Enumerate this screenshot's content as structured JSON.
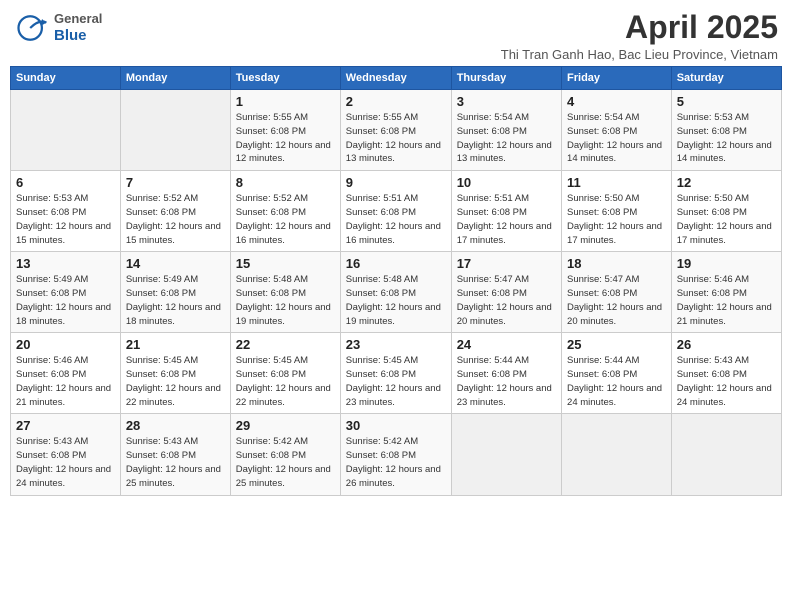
{
  "logo": {
    "general": "General",
    "blue": "Blue"
  },
  "title": "April 2025",
  "subtitle": "Thi Tran Ganh Hao, Bac Lieu Province, Vietnam",
  "days_header": [
    "Sunday",
    "Monday",
    "Tuesday",
    "Wednesday",
    "Thursday",
    "Friday",
    "Saturday"
  ],
  "weeks": [
    [
      {
        "day": "",
        "info": ""
      },
      {
        "day": "",
        "info": ""
      },
      {
        "day": "1",
        "info": "Sunrise: 5:55 AM\nSunset: 6:08 PM\nDaylight: 12 hours and 12 minutes."
      },
      {
        "day": "2",
        "info": "Sunrise: 5:55 AM\nSunset: 6:08 PM\nDaylight: 12 hours and 13 minutes."
      },
      {
        "day": "3",
        "info": "Sunrise: 5:54 AM\nSunset: 6:08 PM\nDaylight: 12 hours and 13 minutes."
      },
      {
        "day": "4",
        "info": "Sunrise: 5:54 AM\nSunset: 6:08 PM\nDaylight: 12 hours and 14 minutes."
      },
      {
        "day": "5",
        "info": "Sunrise: 5:53 AM\nSunset: 6:08 PM\nDaylight: 12 hours and 14 minutes."
      }
    ],
    [
      {
        "day": "6",
        "info": "Sunrise: 5:53 AM\nSunset: 6:08 PM\nDaylight: 12 hours and 15 minutes."
      },
      {
        "day": "7",
        "info": "Sunrise: 5:52 AM\nSunset: 6:08 PM\nDaylight: 12 hours and 15 minutes."
      },
      {
        "day": "8",
        "info": "Sunrise: 5:52 AM\nSunset: 6:08 PM\nDaylight: 12 hours and 16 minutes."
      },
      {
        "day": "9",
        "info": "Sunrise: 5:51 AM\nSunset: 6:08 PM\nDaylight: 12 hours and 16 minutes."
      },
      {
        "day": "10",
        "info": "Sunrise: 5:51 AM\nSunset: 6:08 PM\nDaylight: 12 hours and 17 minutes."
      },
      {
        "day": "11",
        "info": "Sunrise: 5:50 AM\nSunset: 6:08 PM\nDaylight: 12 hours and 17 minutes."
      },
      {
        "day": "12",
        "info": "Sunrise: 5:50 AM\nSunset: 6:08 PM\nDaylight: 12 hours and 17 minutes."
      }
    ],
    [
      {
        "day": "13",
        "info": "Sunrise: 5:49 AM\nSunset: 6:08 PM\nDaylight: 12 hours and 18 minutes."
      },
      {
        "day": "14",
        "info": "Sunrise: 5:49 AM\nSunset: 6:08 PM\nDaylight: 12 hours and 18 minutes."
      },
      {
        "day": "15",
        "info": "Sunrise: 5:48 AM\nSunset: 6:08 PM\nDaylight: 12 hours and 19 minutes."
      },
      {
        "day": "16",
        "info": "Sunrise: 5:48 AM\nSunset: 6:08 PM\nDaylight: 12 hours and 19 minutes."
      },
      {
        "day": "17",
        "info": "Sunrise: 5:47 AM\nSunset: 6:08 PM\nDaylight: 12 hours and 20 minutes."
      },
      {
        "day": "18",
        "info": "Sunrise: 5:47 AM\nSunset: 6:08 PM\nDaylight: 12 hours and 20 minutes."
      },
      {
        "day": "19",
        "info": "Sunrise: 5:46 AM\nSunset: 6:08 PM\nDaylight: 12 hours and 21 minutes."
      }
    ],
    [
      {
        "day": "20",
        "info": "Sunrise: 5:46 AM\nSunset: 6:08 PM\nDaylight: 12 hours and 21 minutes."
      },
      {
        "day": "21",
        "info": "Sunrise: 5:45 AM\nSunset: 6:08 PM\nDaylight: 12 hours and 22 minutes."
      },
      {
        "day": "22",
        "info": "Sunrise: 5:45 AM\nSunset: 6:08 PM\nDaylight: 12 hours and 22 minutes."
      },
      {
        "day": "23",
        "info": "Sunrise: 5:45 AM\nSunset: 6:08 PM\nDaylight: 12 hours and 23 minutes."
      },
      {
        "day": "24",
        "info": "Sunrise: 5:44 AM\nSunset: 6:08 PM\nDaylight: 12 hours and 23 minutes."
      },
      {
        "day": "25",
        "info": "Sunrise: 5:44 AM\nSunset: 6:08 PM\nDaylight: 12 hours and 24 minutes."
      },
      {
        "day": "26",
        "info": "Sunrise: 5:43 AM\nSunset: 6:08 PM\nDaylight: 12 hours and 24 minutes."
      }
    ],
    [
      {
        "day": "27",
        "info": "Sunrise: 5:43 AM\nSunset: 6:08 PM\nDaylight: 12 hours and 24 minutes."
      },
      {
        "day": "28",
        "info": "Sunrise: 5:43 AM\nSunset: 6:08 PM\nDaylight: 12 hours and 25 minutes."
      },
      {
        "day": "29",
        "info": "Sunrise: 5:42 AM\nSunset: 6:08 PM\nDaylight: 12 hours and 25 minutes."
      },
      {
        "day": "30",
        "info": "Sunrise: 5:42 AM\nSunset: 6:08 PM\nDaylight: 12 hours and 26 minutes."
      },
      {
        "day": "",
        "info": ""
      },
      {
        "day": "",
        "info": ""
      },
      {
        "day": "",
        "info": ""
      }
    ]
  ]
}
